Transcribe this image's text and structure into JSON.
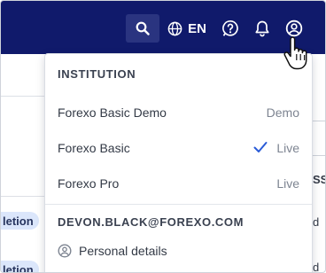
{
  "topbar": {
    "search_icon": "search-icon",
    "language_code": "EN",
    "icons": [
      "globe-icon",
      "help-icon",
      "bell-icon",
      "user-circle-icon"
    ]
  },
  "background": {
    "pill_1": "letion",
    "pill_2": "letion",
    "right_text_1": "SS",
    "right_text_2": "d",
    "right_text_3": "d"
  },
  "dropdown": {
    "institution_heading": "INSTITUTION",
    "institutions": [
      {
        "name": "Forexo Basic Demo",
        "status": "Demo",
        "selected": false
      },
      {
        "name": "Forexo Basic",
        "status": "Live",
        "selected": true
      },
      {
        "name": "Forexo Pro",
        "status": "Live",
        "selected": false
      }
    ],
    "account_email": "DEVON.BLACK@FOREXO.COM",
    "personal_details_label": "Personal details"
  },
  "colors": {
    "topbar": "#101a6b",
    "check": "#2a5bd7",
    "pill": "#dbe6fb"
  }
}
